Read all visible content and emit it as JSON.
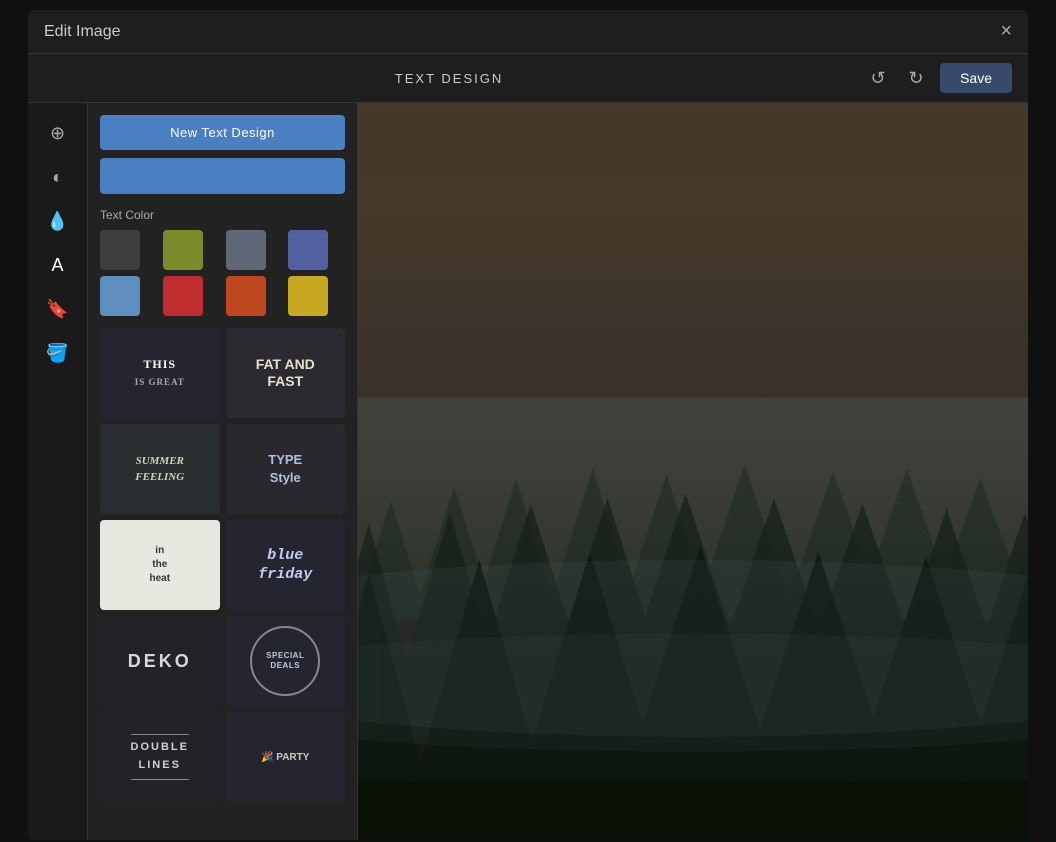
{
  "modal": {
    "title": "Edit Image",
    "close_label": "×"
  },
  "toolbar": {
    "section_title": "TEXT DESIGN",
    "undo_label": "↺",
    "redo_label": "↻",
    "save_label": "Save"
  },
  "rail_icons": [
    {
      "name": "crop-icon",
      "symbol": "⊞"
    },
    {
      "name": "brightness-icon",
      "symbol": "☀"
    },
    {
      "name": "contrast-icon",
      "symbol": "◑"
    },
    {
      "name": "text-icon",
      "symbol": "A"
    },
    {
      "name": "bookmark-icon",
      "symbol": "🔖"
    },
    {
      "name": "paint-icon",
      "symbol": "🪣"
    }
  ],
  "panel": {
    "new_text_btn": "New Text Design",
    "text_color_label": "Text Color",
    "colors": [
      {
        "hex": "#3d3d3d",
        "name": "dark-gray"
      },
      {
        "hex": "#7a8c2a",
        "name": "olive-green"
      },
      {
        "hex": "#606878",
        "name": "slate-gray"
      },
      {
        "hex": "#5060a0",
        "name": "blue-gray"
      },
      {
        "hex": "#6090c0",
        "name": "sky-blue"
      },
      {
        "hex": "#c03030",
        "name": "red"
      },
      {
        "hex": "#c04820",
        "name": "orange-red"
      },
      {
        "hex": "#c8a820",
        "name": "gold"
      }
    ],
    "styles": [
      {
        "id": "style-1",
        "label": "THIS\nIS GREAT"
      },
      {
        "id": "style-2",
        "label": "FAT AND\nFAST"
      },
      {
        "id": "style-3",
        "label": "SUMMER\nFEELING"
      },
      {
        "id": "style-4",
        "label": "TYPE\nStyle"
      },
      {
        "id": "style-5",
        "label": "in\nthe\nheat"
      },
      {
        "id": "style-6",
        "label": "blue\nfriday"
      },
      {
        "id": "style-7",
        "label": "DEKO"
      },
      {
        "id": "style-8",
        "label": "SPECIAL\nDEALS"
      },
      {
        "id": "style-9",
        "label": "DOUBLE\nLINES"
      },
      {
        "id": "style-10",
        "label": "PARTY"
      }
    ]
  }
}
